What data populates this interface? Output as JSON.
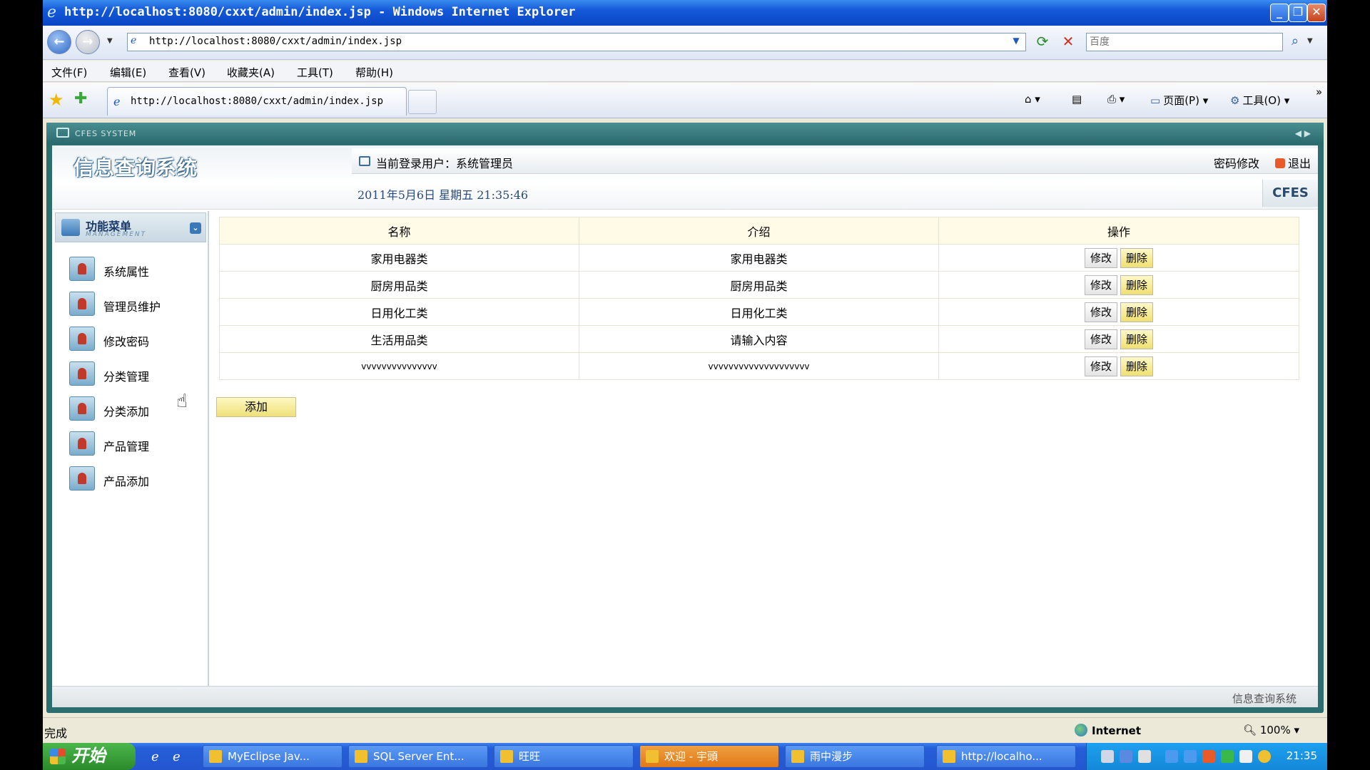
{
  "window": {
    "title": "http://localhost:8080/cxxt/admin/index.jsp - Windows Internet Explorer"
  },
  "address": {
    "url": "http://localhost:8080/cxxt/admin/index.jsp",
    "search_placeholder": "百度"
  },
  "menu": [
    "文件(F)",
    "编辑(E)",
    "查看(V)",
    "收藏夹(A)",
    "工具(T)",
    "帮助(H)"
  ],
  "tab": {
    "label": "http://localhost:8080/cxxt/admin/index.jsp"
  },
  "toolbar": {
    "page_label": "页面(P)",
    "tools_label": "工具(O)"
  },
  "app": {
    "system_label": "CFES SYSTEM",
    "logo_title": "信息查询系统",
    "current_user": "当前登录用户：系统管理员",
    "password_link": "密码修改",
    "logout_link": "退出",
    "datetime": "2011年5月6日  星期五  21:35:46",
    "badge": "CFES",
    "footer": "信息查询系统"
  },
  "sidebar": {
    "title": "功能菜单",
    "subtitle": "MANAGEMENT",
    "items": [
      {
        "label": "系统属性"
      },
      {
        "label": "管理员维护"
      },
      {
        "label": "修改密码"
      },
      {
        "label": "分类管理"
      },
      {
        "label": "分类添加"
      },
      {
        "label": "产品管理"
      },
      {
        "label": "产品添加"
      }
    ]
  },
  "table": {
    "headers": [
      "名称",
      "介绍",
      "操作"
    ],
    "rows": [
      {
        "name": "家用电器类",
        "desc": "家用电器类"
      },
      {
        "name": "厨房用品类",
        "desc": "厨房用品类"
      },
      {
        "name": "日用化工类",
        "desc": "日用化工类"
      },
      {
        "name": "生活用品类",
        "desc": "请输入内容"
      },
      {
        "name": "vvvvvvvvvvvvvvv",
        "desc": "vvvvvvvvvvvvvvvvvvvv"
      }
    ],
    "edit_label": "修改",
    "delete_label": "删除",
    "add_label": "添加"
  },
  "statusbar": {
    "status": "完成",
    "zone": "Internet",
    "zoom": "100%"
  },
  "taskbar": {
    "start": "开始",
    "tasks": [
      {
        "label": "MyEclipse Jav..."
      },
      {
        "label": "SQL Server Ent..."
      },
      {
        "label": "旺旺"
      },
      {
        "label": "欢迎 - 宇頭"
      },
      {
        "label": "雨中漫步"
      },
      {
        "label": "http://localho..."
      }
    ],
    "clock": "21:35"
  },
  "colors": {
    "app_frame": "#2c6d70",
    "table_header_bg": "#fffbe6",
    "delete_button_bg": "#f0e070",
    "taskbar_blue": "#245ed8"
  }
}
